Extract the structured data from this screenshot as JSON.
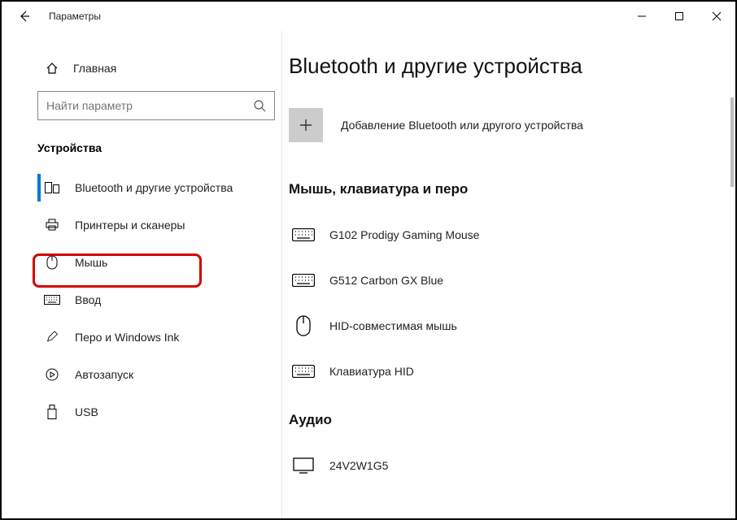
{
  "titlebar": {
    "app_name": "Параметры"
  },
  "sidebar": {
    "home_label": "Главная",
    "search_placeholder": "Найти параметр",
    "section_label": "Устройства",
    "items": [
      {
        "label": "Bluetooth и другие устройства"
      },
      {
        "label": "Принтеры и сканеры"
      },
      {
        "label": "Мышь"
      },
      {
        "label": "Ввод"
      },
      {
        "label": "Перо и Windows Ink"
      },
      {
        "label": "Автозапуск"
      },
      {
        "label": "USB"
      }
    ]
  },
  "main": {
    "page_title": "Bluetooth и другие устройства",
    "add_label": "Добавление Bluetooth или другого устройства",
    "group1_title": "Мышь, клавиатура и перо",
    "devices1": [
      {
        "label": "G102 Prodigy Gaming Mouse",
        "icon": "keyboard"
      },
      {
        "label": "G512 Carbon GX Blue",
        "icon": "keyboard"
      },
      {
        "label": "HID-совместимая мышь",
        "icon": "mouse"
      },
      {
        "label": "Клавиатура HID",
        "icon": "keyboard"
      }
    ],
    "group2_title": "Аудио",
    "devices2": [
      {
        "label": "24V2W1G5",
        "icon": "monitor"
      }
    ]
  }
}
